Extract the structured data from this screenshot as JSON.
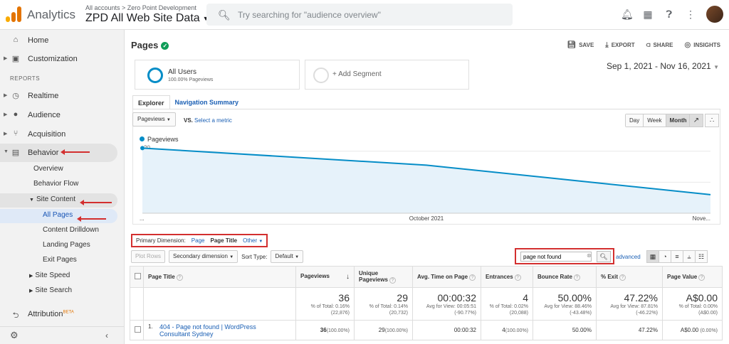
{
  "app": {
    "name": "Analytics",
    "account_path": "All accounts > Zero Point Development",
    "property": "ZPD All Web Site Data",
    "search_placeholder": "Try searching for \"audience overview\""
  },
  "sidebar": {
    "home": "Home",
    "customization": "Customization",
    "reports_label": "REPORTS",
    "realtime": "Realtime",
    "audience": "Audience",
    "acquisition": "Acquisition",
    "behavior": "Behavior",
    "overview": "Overview",
    "behavior_flow": "Behavior Flow",
    "site_content": "Site Content",
    "all_pages": "All Pages",
    "content_drilldown": "Content Drilldown",
    "landing_pages": "Landing Pages",
    "exit_pages": "Exit Pages",
    "site_speed": "Site Speed",
    "site_search": "Site Search",
    "attribution": "Attribution",
    "beta": "BETA"
  },
  "page": {
    "title": "Pages",
    "actions": {
      "save": "SAVE",
      "export": "EXPORT",
      "share": "SHARE",
      "insights": "INSIGHTS"
    },
    "segment_name": "All Users",
    "segment_sub": "100.00% Pageviews",
    "add_segment": "+ Add Segment",
    "date_range": "Sep 1, 2021 - Nov 16, 2021",
    "tabs": {
      "explorer": "Explorer",
      "nav_summary": "Navigation Summary"
    },
    "metric": "Pageviews",
    "vs": "VS.",
    "select_metric": "Select a metric",
    "granularity": {
      "day": "Day",
      "week": "Week",
      "month": "Month"
    }
  },
  "chart_data": {
    "type": "area",
    "series": [
      {
        "name": "Pageviews",
        "values": [
          21,
          15.5,
          6
        ]
      }
    ],
    "x": [
      "...",
      "October 2021",
      "Nove..."
    ],
    "y_ticks": [
      "20",
      "10"
    ],
    "ylim": [
      0,
      22
    ],
    "color": "#058dc7",
    "fill": "#e6f2fa",
    "grid": true
  },
  "table_controls": {
    "primary_dimension_label": "Primary Dimension:",
    "dim_page": "Page",
    "dim_page_title": "Page Title",
    "dim_other": "Other",
    "plot_rows": "Plot Rows",
    "secondary_dimension": "Secondary dimension",
    "sort_type_label": "Sort Type:",
    "sort_type": "Default",
    "filter_value": "page not found",
    "advanced": "advanced"
  },
  "table": {
    "headers": {
      "title": "Page Title",
      "pageviews": "Pageviews",
      "unique": "Unique Pageviews",
      "avg_time": "Avg. Time on Page",
      "entrances": "Entrances",
      "bounce": "Bounce Rate",
      "exit": "% Exit",
      "value": "Page Value"
    },
    "totals": {
      "pageviews": "36",
      "pageviews_sub": "% of Total: 0.16%",
      "pageviews_sub2": "(22,876)",
      "unique": "29",
      "unique_sub": "% of Total: 0.14%",
      "unique_sub2": "(20,732)",
      "avg_time": "00:00:32",
      "avg_time_sub": "Avg for View: 00:05:51",
      "avg_time_sub2": "(-90.77%)",
      "entrances": "4",
      "entrances_sub": "% of Total: 0.02%",
      "entrances_sub2": "(20,088)",
      "bounce": "50.00%",
      "bounce_sub": "Avg for View: 88.46%",
      "bounce_sub2": "(-43.48%)",
      "exit": "47.22%",
      "exit_sub": "Avg for View: 87.81%",
      "exit_sub2": "(-46.22%)",
      "value": "A$0.00",
      "value_sub": "% of Total: 0.00%",
      "value_sub2": "(A$0.00)"
    },
    "rows": [
      {
        "index": "1.",
        "title": "404 - Page not found | WordPress Consultant Sydney",
        "pageviews": "36",
        "pageviews_pct": "(100.00%)",
        "unique": "29",
        "unique_pct": "(100.00%)",
        "avg_time": "00:00:32",
        "entrances": "4",
        "entrances_pct": "(100.00%)",
        "bounce": "50.00%",
        "exit": "47.22%",
        "value": "A$0.00",
        "value_pct": "(0.00%)"
      }
    ]
  }
}
